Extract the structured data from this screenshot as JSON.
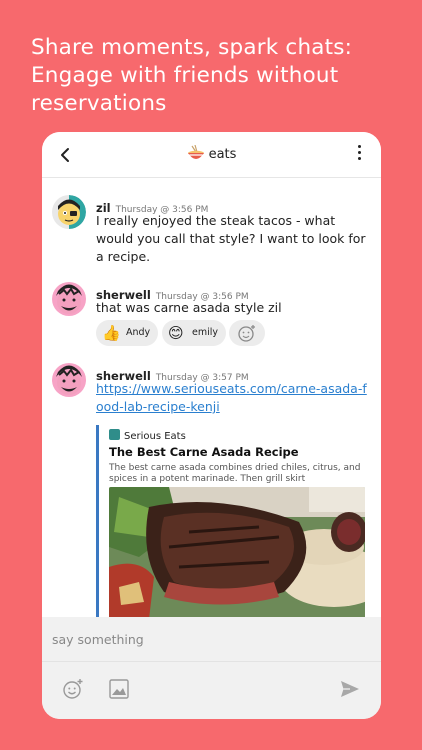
{
  "headline": "Share moments, spark chats: Engage with friends without reservations",
  "header": {
    "channel_name": "eats",
    "channel_icon": "noodle-bowl-icon"
  },
  "messages": [
    {
      "author": "zil",
      "timestamp": "Thursday @ 3:56 PM",
      "text": "I really enjoyed the steak tacos - what would you call that style? I want to look for a recipe."
    },
    {
      "author": "sherwell",
      "timestamp": "Thursday @ 3:56 PM",
      "text": "that was carne asada style zil",
      "reactions": [
        {
          "emoji": "👍",
          "name": "Andy"
        },
        {
          "emoji": "😊",
          "name": "emily"
        }
      ]
    },
    {
      "author": "sherwell",
      "timestamp": "Thursday @ 3:57 PM",
      "link": "https://www.seriouseats.com/carne-asada-food-lab-recipe-kenji",
      "preview": {
        "site": "Serious Eats",
        "title": "The Best Carne Asada Recipe",
        "description": "The best carne asada combines dried chiles, citrus, and spices in a potent marinade. Then grill skirt"
      }
    }
  ],
  "composer": {
    "placeholder": "say something"
  },
  "colors": {
    "background": "#f7696d",
    "link": "#2a7fcf",
    "preview_bar": "#3a78c2"
  }
}
